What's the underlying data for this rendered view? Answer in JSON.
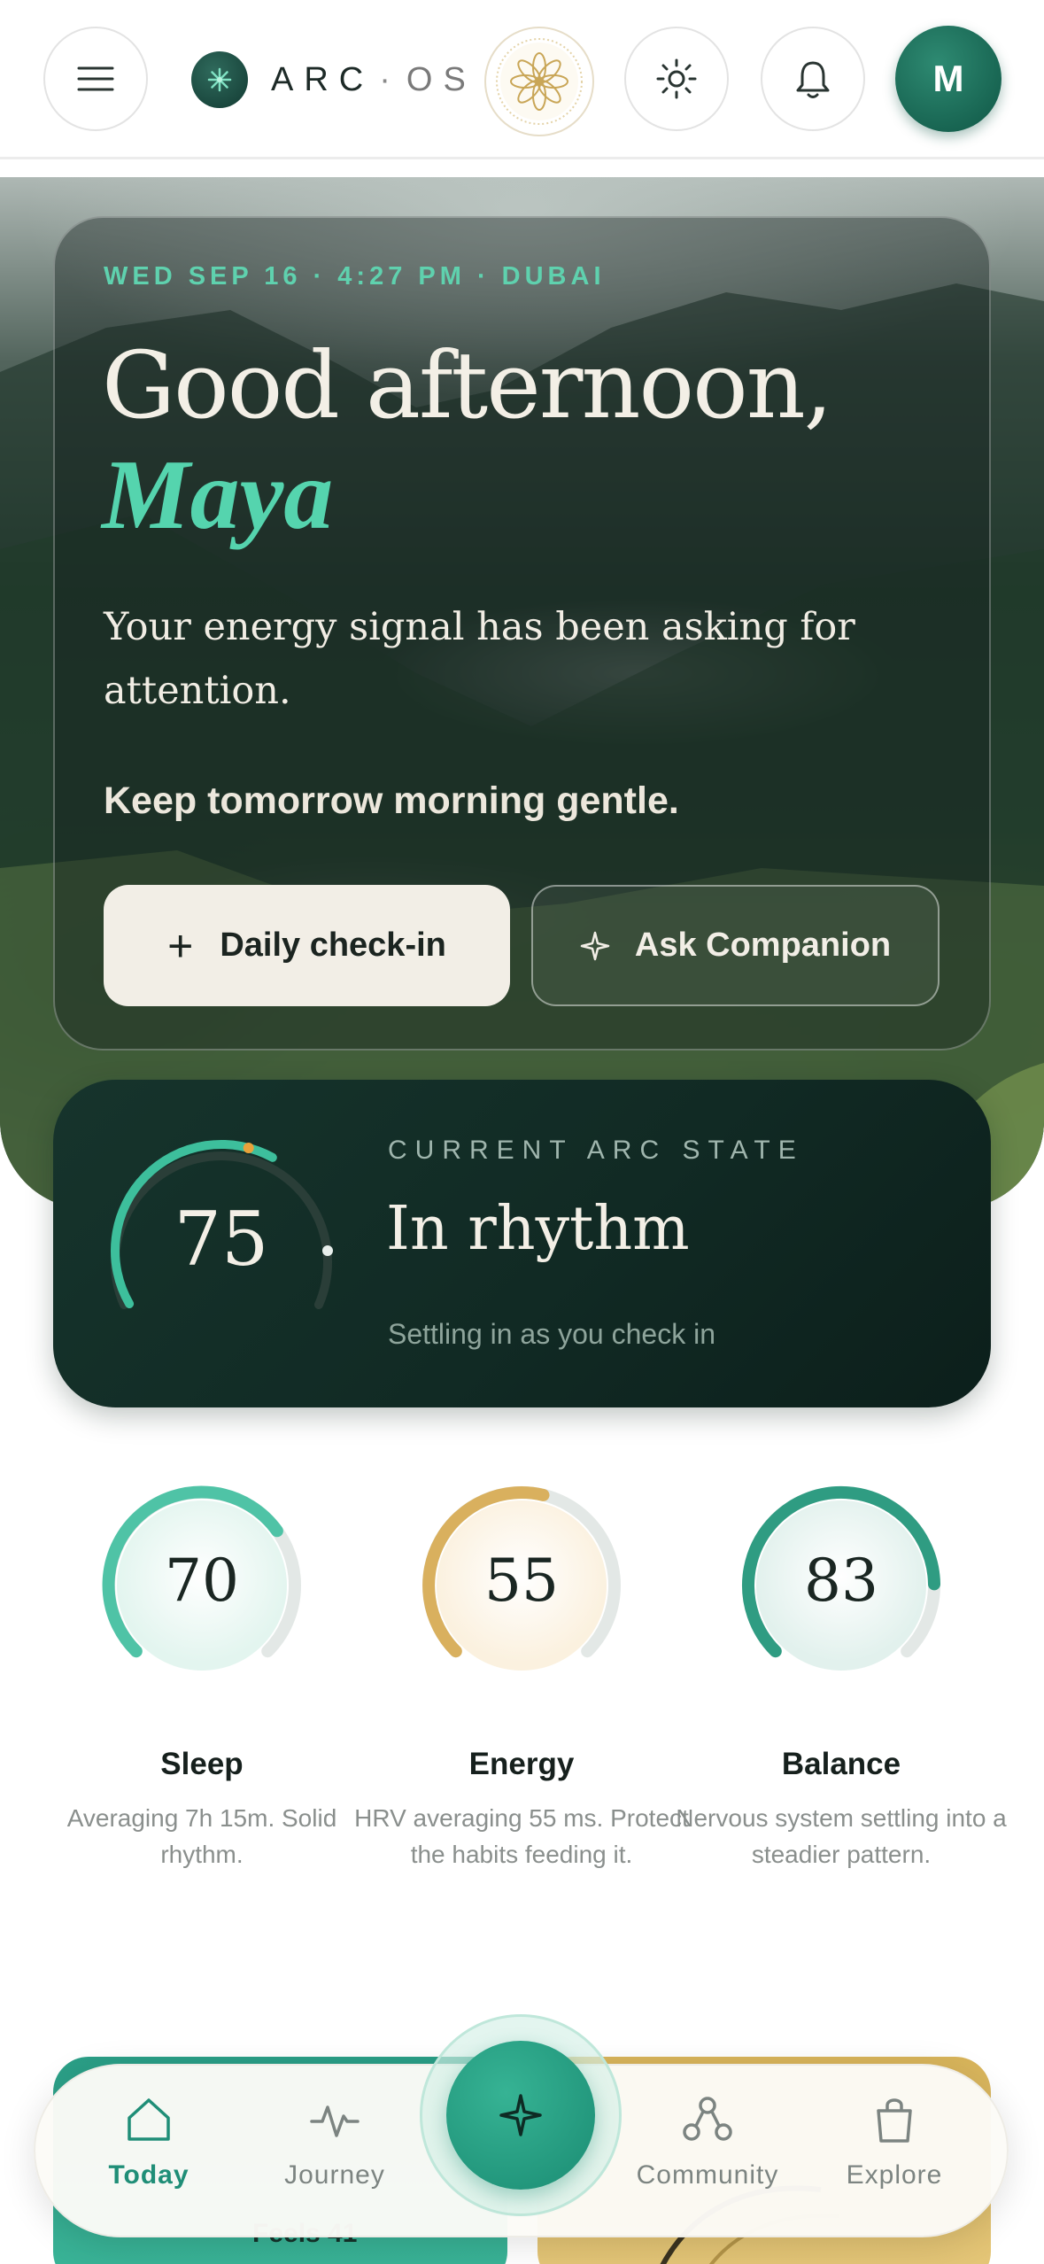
{
  "header": {
    "menu_icon": "hamburger-menu-icon",
    "brand_word": "ARC",
    "brand_sep": "·",
    "brand_suffix": "OS",
    "mandala_icon": "mandala-flower-icon",
    "theme_icon": "sun-icon",
    "notifications_icon": "bell-icon",
    "avatar_initial": "M"
  },
  "hero": {
    "date_line": "WED SEP 16 · 4:27 PM · DUBAI",
    "greeting": "Good afternoon,",
    "name": "Maya",
    "message": "Your energy signal has been asking for attention.",
    "tip": "Keep tomorrow morning gentle.",
    "checkin_label": "Daily check-in",
    "checkin_icon": "plus-icon",
    "companion_label": "Ask Companion",
    "companion_icon": "sparkle-icon"
  },
  "arc_state": {
    "label": "CURRENT ARC STATE",
    "score": "75",
    "score_value": 75,
    "state": "In rhythm",
    "subtitle": "Settling in as you check in"
  },
  "metrics": [
    {
      "value": "70",
      "level": 70,
      "title": "Sleep",
      "desc": "Averaging 7h 15m. Solid rhythm.",
      "color": "#4fc3a6"
    },
    {
      "value": "55",
      "level": 55,
      "title": "Energy",
      "desc": "HRV averaging 55 ms. Protect the habits feeding it.",
      "color": "#d9b05e"
    },
    {
      "value": "83",
      "level": 83,
      "title": "Balance",
      "desc": "Nervous system settling into a steadier pattern.",
      "color": "#2f9c82"
    }
  ],
  "peek": {
    "text": "Feels 41"
  },
  "nav": {
    "items": [
      {
        "label": "Today",
        "icon": "home-icon",
        "active": true
      },
      {
        "label": "Journey",
        "icon": "pulse-icon",
        "active": false
      },
      {
        "label": "Community",
        "icon": "network-icon",
        "active": false
      },
      {
        "label": "Explore",
        "icon": "shopping-bag-icon",
        "active": false
      }
    ],
    "fab_icon": "sparkle-icon"
  },
  "colors": {
    "accent": "#1f8e77",
    "accent_light": "#55d4ae",
    "dark_card": "#112a24",
    "gold": "#d9b05e"
  }
}
